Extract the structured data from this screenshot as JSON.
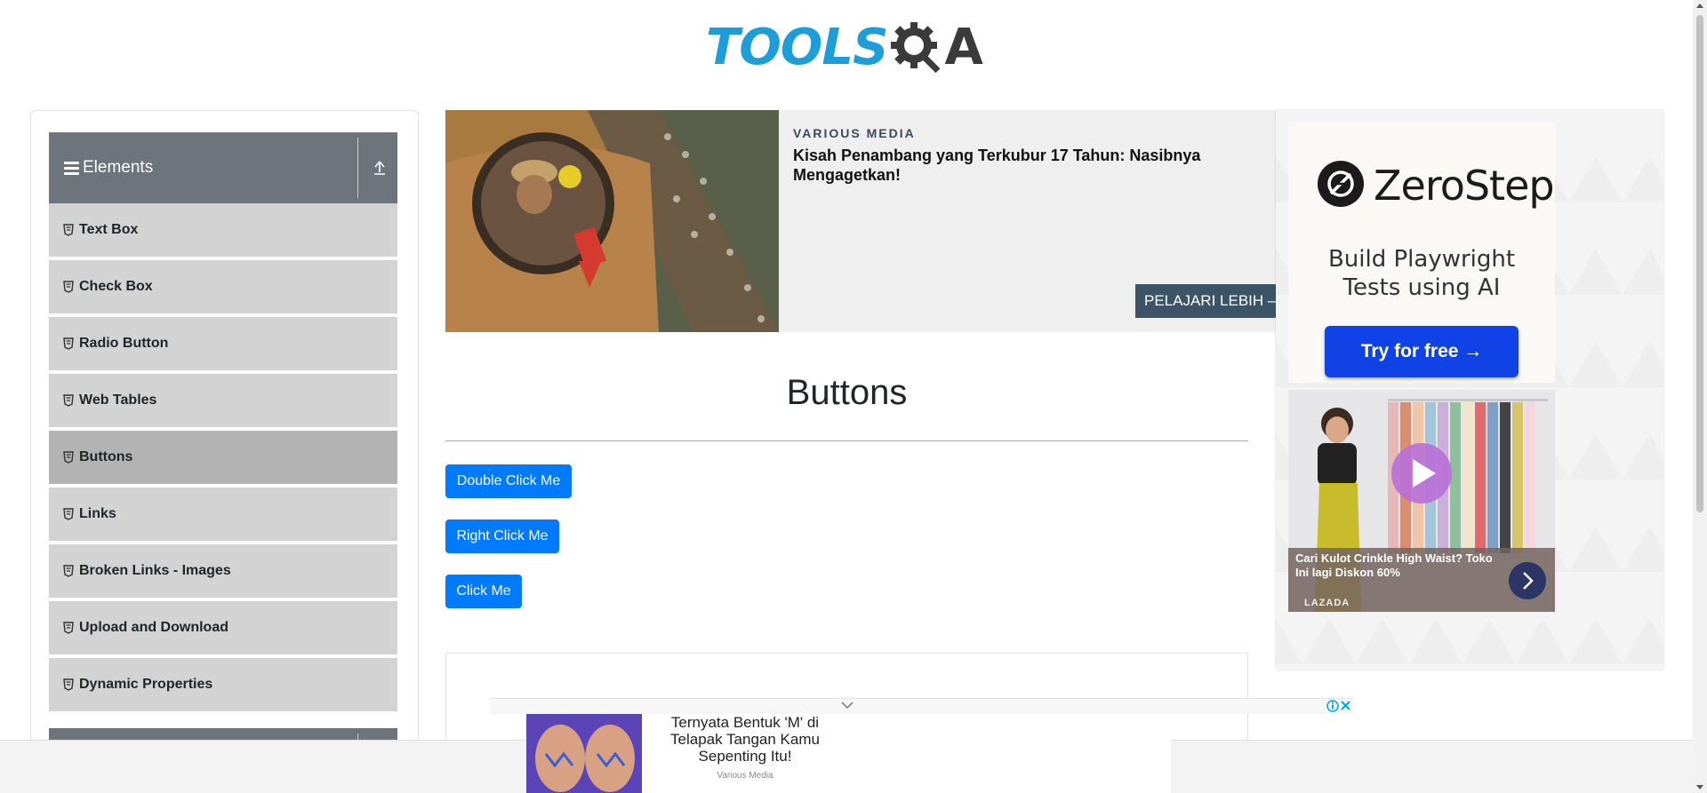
{
  "logo": {
    "text_tools": "TOOLS",
    "text_a": "A",
    "colors": {
      "tools": "#1d9ed8",
      "qa": "#3b3b3b"
    }
  },
  "sidebar": {
    "group_title": "Elements",
    "items": [
      {
        "label": "Text Box",
        "active": false
      },
      {
        "label": "Check Box",
        "active": false
      },
      {
        "label": "Radio Button",
        "active": false
      },
      {
        "label": "Web Tables",
        "active": false
      },
      {
        "label": "Buttons",
        "active": true
      },
      {
        "label": "Links",
        "active": false
      },
      {
        "label": "Broken Links - Images",
        "active": false
      },
      {
        "label": "Upload and Download",
        "active": false
      },
      {
        "label": "Dynamic Properties",
        "active": false
      }
    ]
  },
  "top_ad": {
    "source": "VARIOUS MEDIA",
    "headline": "Kisah Penambang yang Terkubur 17 Tahun: Nasibnya Mengagetkan!",
    "cta": "PELAJARI LEBIH –"
  },
  "main": {
    "title": "Buttons",
    "buttons": {
      "double_click": "Double Click Me",
      "right_click": "Right Click Me",
      "click": "Click Me"
    }
  },
  "right_ad": {
    "brand": "ZeroStep",
    "tagline_1": "Build Playwright",
    "tagline_2": "Tests using AI",
    "cta": "Try for free →",
    "video_caption": "Cari Kulot Crinkle High Waist? Toko Ini lagi Diskon 60%",
    "video_brand": "LAZADA"
  },
  "bottom_ad": {
    "text": "Ternyata Bentuk 'M' di Telapak Tangan Kamu Sepenting Itu!",
    "source": "Various Media"
  },
  "colors": {
    "primary_button": "#007bff",
    "sidebar_header": "#6d747c",
    "sidebar_item": "#d3d3d3",
    "sidebar_active": "#b3b3b3"
  }
}
